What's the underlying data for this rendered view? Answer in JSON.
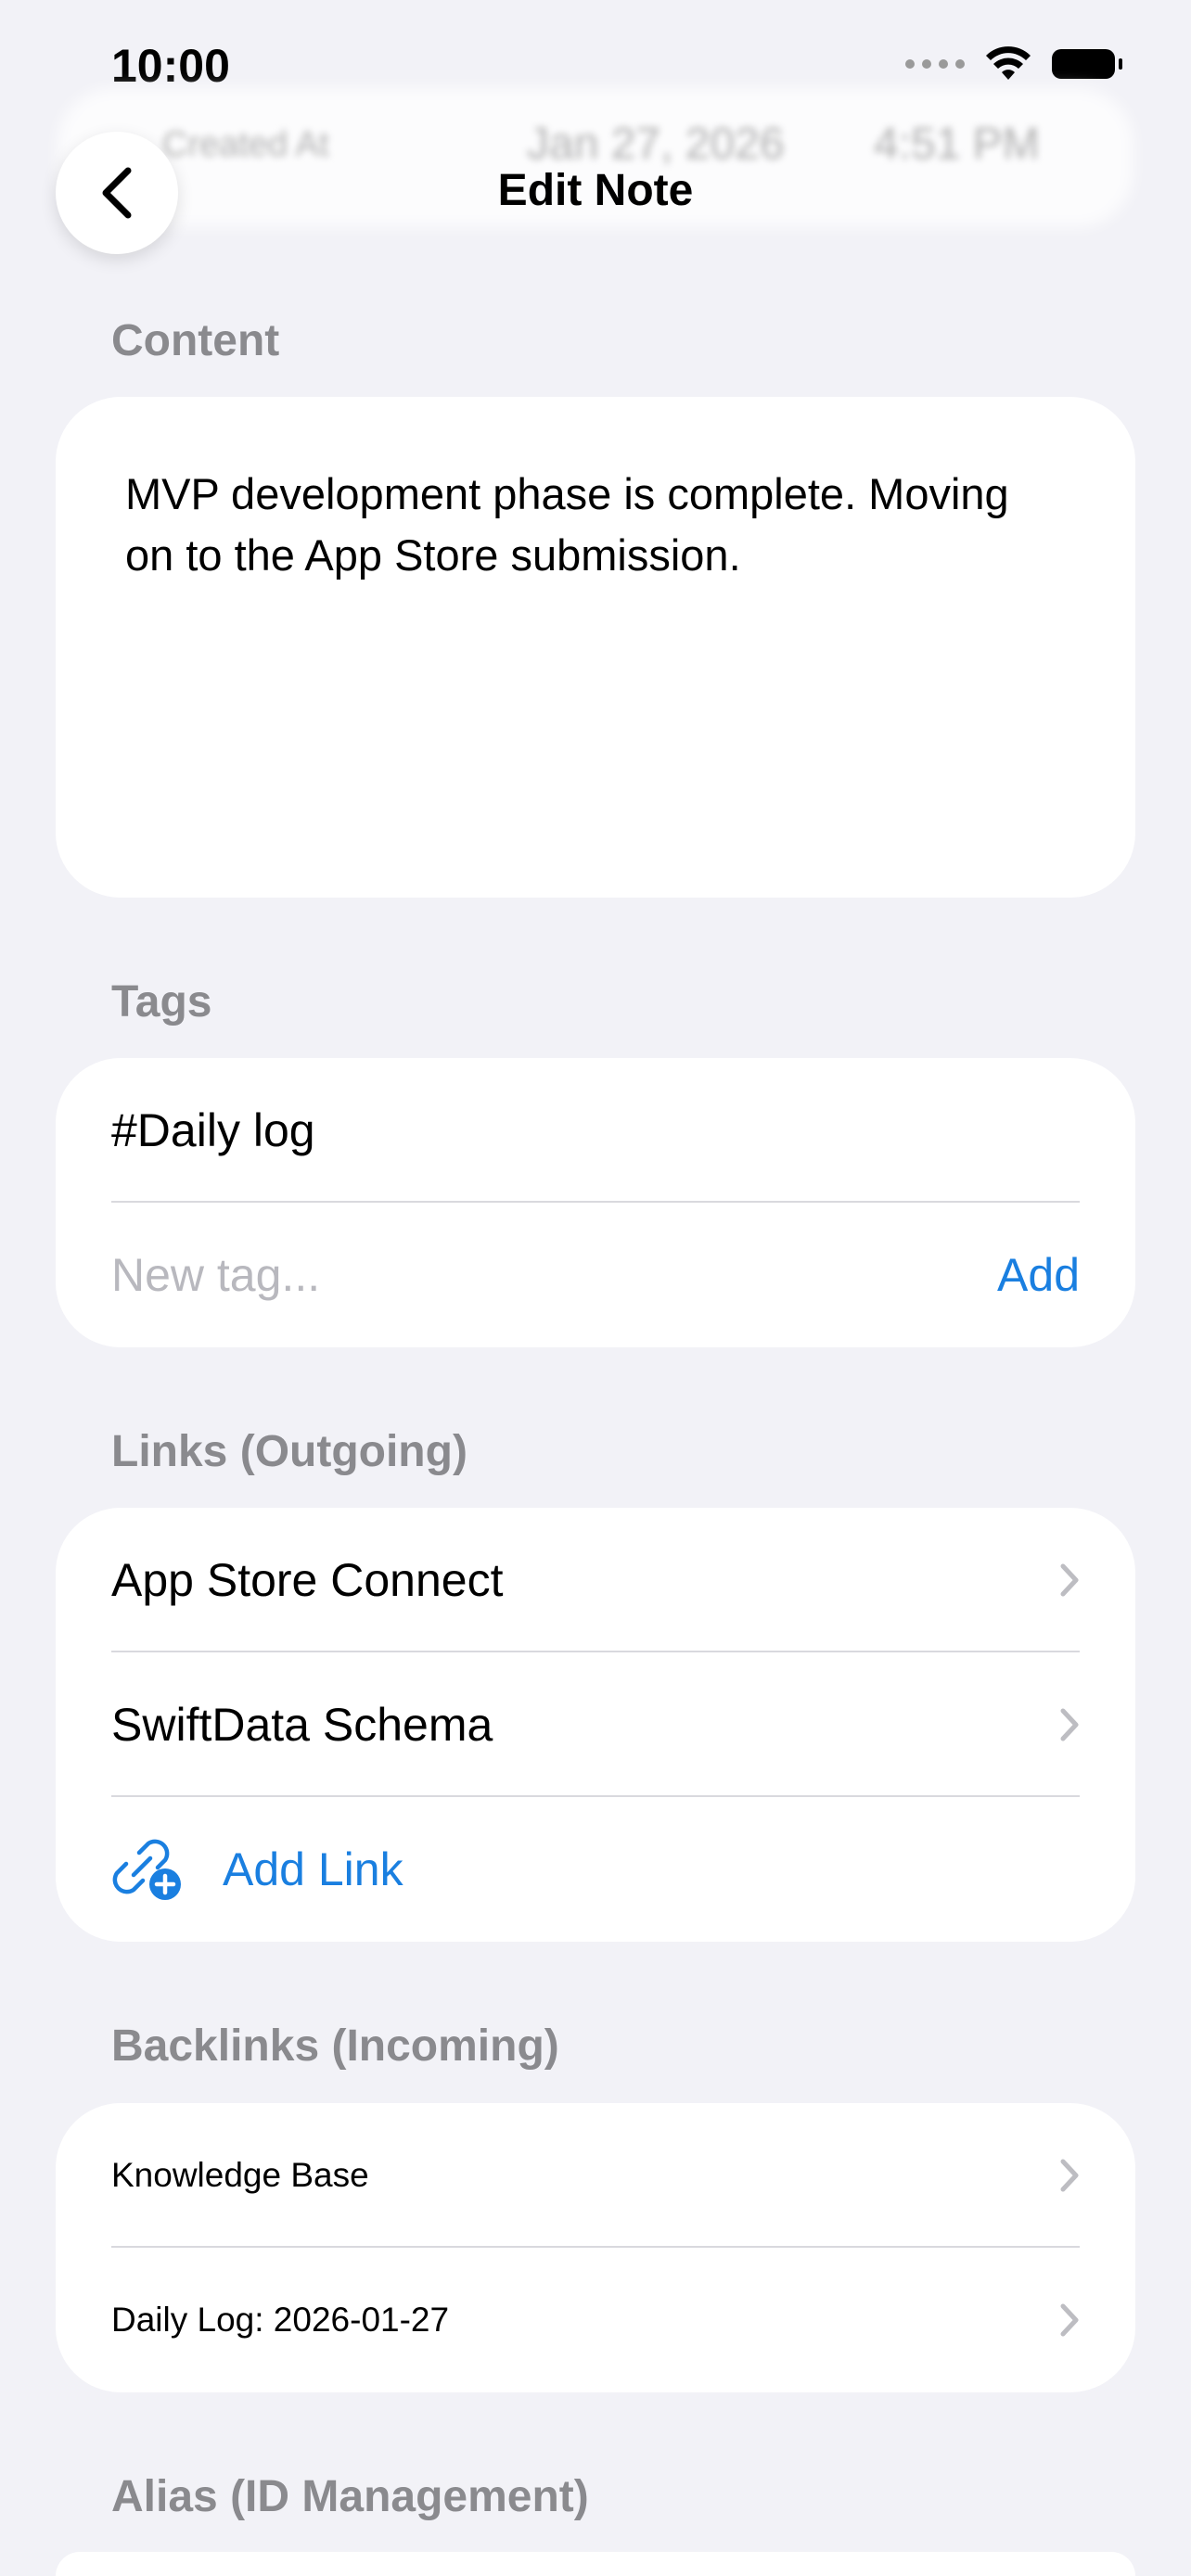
{
  "status_bar": {
    "time": "10:00"
  },
  "faded_header": {
    "label": "Created At",
    "date": "Jan 27, 2026",
    "time": "4:51 PM"
  },
  "nav": {
    "title": "Edit Note"
  },
  "content": {
    "header": "Content",
    "text": "MVP development phase is complete. Moving on to the App Store submission."
  },
  "tags": {
    "header": "Tags",
    "items": [
      "#Daily log"
    ],
    "new_placeholder": "New tag...",
    "add_label": "Add"
  },
  "links": {
    "header": "Links (Outgoing)",
    "items": [
      "App Store Connect",
      "SwiftData Schema"
    ],
    "add_label": "Add Link"
  },
  "backlinks": {
    "header": "Backlinks (Incoming)",
    "items": [
      "Knowledge Base",
      "Daily Log: 2026-01-27"
    ]
  },
  "alias": {
    "header": "Alias (ID Management)"
  },
  "colors": {
    "accent": "#1A7FE0",
    "background": "#F2F2F7",
    "section_header": "#8A8A8E"
  }
}
